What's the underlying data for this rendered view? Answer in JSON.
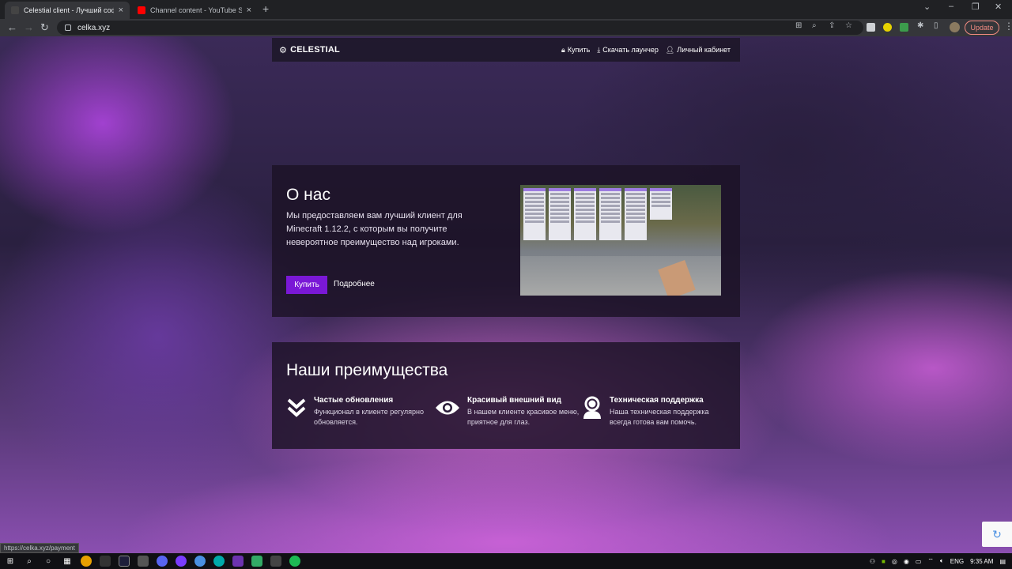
{
  "browser": {
    "tabs": [
      {
        "title": "Celestial client - Лучший софт д",
        "active": true,
        "favicon_color": "#1a1a1a"
      },
      {
        "title": "Channel content - YouTube Studi",
        "active": false,
        "favicon_color": "#ff0000"
      }
    ],
    "new_tab_symbol": "+",
    "url": "celka.xyz",
    "update_label": "Update",
    "status_url": "https://celka.xyz/payment"
  },
  "site": {
    "logo_text": "CELESTIAL",
    "nav": [
      {
        "label": "Купить",
        "icon": "bag-icon"
      },
      {
        "label": "Скачать лаунчер",
        "icon": "download-icon"
      },
      {
        "label": "Личный кабинет",
        "icon": "user-icon"
      }
    ],
    "about": {
      "heading": "О нас",
      "text": "Мы предоставляем вам лучший клиент для Minecraft 1.12.2, с которым вы получите невероятное преимущество над игроками.",
      "buy_label": "Купить",
      "more_label": "Подробнее"
    },
    "advantages": {
      "heading": "Наши преимущества",
      "items": [
        {
          "title": "Частые обновления",
          "desc": "Функционал в клиенте регулярно обновляется.",
          "icon": "double-chevron-down-icon"
        },
        {
          "title": "Красивый внешний вид",
          "desc": "В нашем клиенте красивое меню, приятное для глаз.",
          "icon": "eye-icon"
        },
        {
          "title": "Техническая поддержка",
          "desc": "Наша техническая поддержка всегда готова вам помочь.",
          "icon": "support-agent-icon"
        }
      ]
    },
    "accent_color": "#7a18d6"
  },
  "taskbar": {
    "lang": "ENG",
    "time": "9:35 AM"
  }
}
